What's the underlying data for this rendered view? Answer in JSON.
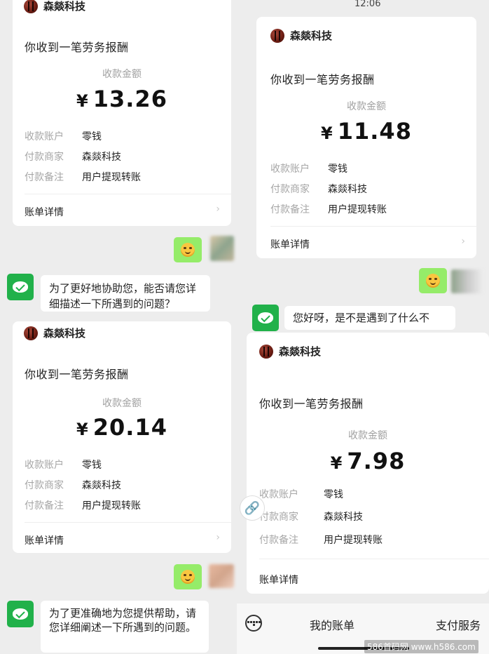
{
  "time": "12:06",
  "merchant": "森燚科技",
  "headline": "你收到一笔劳务报酬",
  "amount_label": "收款金额",
  "currency": "¥",
  "labels": {
    "account": "收款账户",
    "payer": "付款商家",
    "note": "付款备注"
  },
  "values": {
    "account": "零钱",
    "payer": "森燚科技",
    "note": "用户提现转账"
  },
  "detail": "账单详情",
  "amounts": [
    "13.26",
    "11.48",
    "20.14",
    "7.98"
  ],
  "messages": {
    "m1": "为了更好地协助您，能否请您详细描述一下所遇到的问题？",
    "m2": "您好呀，是不是遇到了什么不",
    "m3": "为了更准确地为您提供帮助，请您详细阐述一下所遇到的问题。"
  },
  "bottom_bar": {
    "my_bill": "我的账单",
    "pay_service": "支付服务"
  },
  "watermark": "586首码网 www.h586.com",
  "colors": {
    "bg": "#ededed",
    "bubble_green": "#95ec69",
    "bot_green": "#21b14a"
  }
}
